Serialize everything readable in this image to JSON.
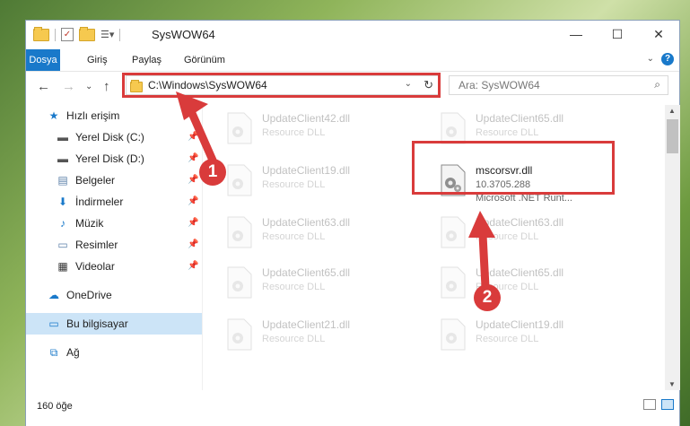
{
  "window": {
    "title": "SysWOW64"
  },
  "ribbon": {
    "tabs": [
      "Dosya",
      "Giriş",
      "Paylaş",
      "Görünüm"
    ],
    "help": "?"
  },
  "address": {
    "path": "C:\\Windows\\SysWOW64"
  },
  "search": {
    "placeholder": "Ara: SysWOW64"
  },
  "sidebar": {
    "quick_access": "Hızlı erişim",
    "items": [
      {
        "label": "Yerel Disk (C:)",
        "icon": "drive-icon"
      },
      {
        "label": "Yerel Disk (D:)",
        "icon": "drive-icon"
      },
      {
        "label": "Belgeler",
        "icon": "documents-icon"
      },
      {
        "label": "İndirmeler",
        "icon": "download-icon"
      },
      {
        "label": "Müzik",
        "icon": "music-icon"
      },
      {
        "label": "Resimler",
        "icon": "pictures-icon"
      },
      {
        "label": "Videolar",
        "icon": "videos-icon"
      }
    ],
    "onedrive": "OneDrive",
    "this_pc": "Bu bilgisayar",
    "network": "Ağ"
  },
  "files": [
    {
      "name": "UpdateClient42.dll",
      "desc": "Resource DLL"
    },
    {
      "name": "UpdateClient65.dll",
      "desc": "Resource DLL"
    },
    {
      "name": "UpdateClient19.dll",
      "desc": "Resource DLL"
    },
    {
      "name": "mscorsvr.dll",
      "desc": "10.3705.288",
      "desc2": "Microsoft .NET Runt..."
    },
    {
      "name": "UpdateClient63.dll",
      "desc": "Resource DLL"
    },
    {
      "name": "UpdateClient63.dll",
      "desc": "Resource DLL"
    },
    {
      "name": "UpdateClient65.dll",
      "desc": "Resource DLL"
    },
    {
      "name": "UpdateClient65.dll",
      "desc": "Resource DLL"
    },
    {
      "name": "UpdateClient21.dll",
      "desc": "Resource DLL"
    },
    {
      "name": "UpdateClient19.dll",
      "desc": "Resource DLL"
    }
  ],
  "status": {
    "count": "160 öğe"
  },
  "callouts": {
    "one": "1",
    "two": "2"
  },
  "colors": {
    "accent": "#1979ca",
    "highlight": "#d93b3b"
  }
}
